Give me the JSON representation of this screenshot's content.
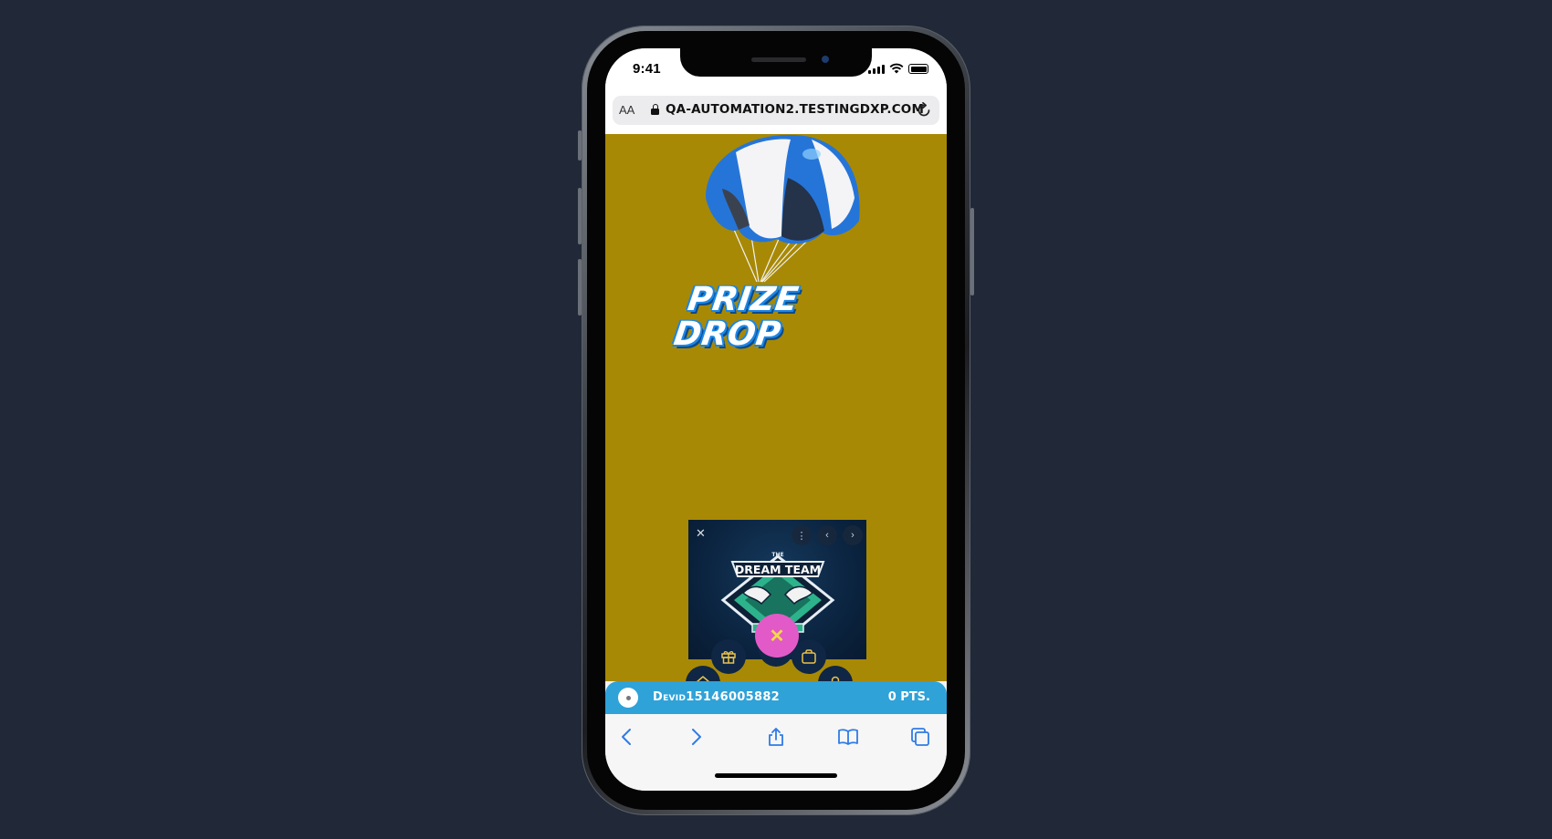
{
  "status_bar": {
    "time": "9:41"
  },
  "browser": {
    "text_size_label": "AA",
    "url": "QA-AUTOMATION2.TESTINGDXP.COM",
    "icons": [
      "lock-icon",
      "reload-icon",
      "back-icon",
      "forward-icon",
      "share-icon",
      "bookmarks-icon",
      "tabs-icon"
    ]
  },
  "page": {
    "background_color": "#a88905",
    "logo": {
      "line1": "PRIZE",
      "line2": "DROP"
    },
    "video": {
      "close_glyph": "✕",
      "menu_glyph": "⋮",
      "prev_glyph": "‹",
      "next_glyph": "›",
      "badge": {
        "top_text": "THE",
        "title": "DREAM TEAM"
      }
    },
    "radial_menu": {
      "help_glyph": "?",
      "close_glyph": "✕",
      "items": [
        "home-icon",
        "gift-icon",
        "help-icon",
        "bag-icon",
        "user-icon"
      ]
    },
    "user_bar": {
      "username": "Devid15146005882",
      "points": "0 PTS."
    }
  },
  "colors": {
    "page_bg": "#212838",
    "accent_blue": "#2fa2d8",
    "fab_navy": "#0f2645",
    "fab_icon_yellow": "#e9c24a",
    "close_pink": "#e25ac7"
  }
}
